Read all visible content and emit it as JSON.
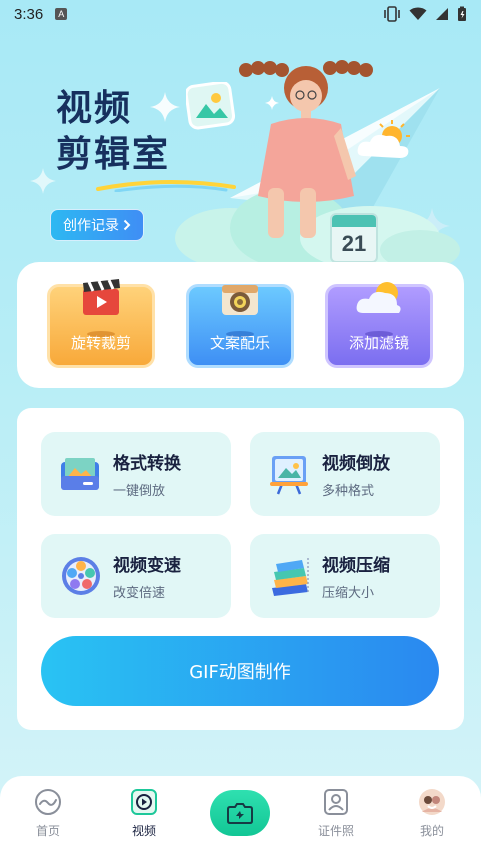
{
  "status": {
    "time": "3:36",
    "notification_letter": "A"
  },
  "hero": {
    "title_line1": "视频",
    "title_line2": "剪辑室",
    "record_button": "创作记录",
    "calendar_day": "21"
  },
  "tools": [
    {
      "label": "旋转裁剪",
      "icon": "clapperboard-icon",
      "color": "#f8a93a"
    },
    {
      "label": "文案配乐",
      "icon": "camera-icon",
      "color": "#3e8ff4"
    },
    {
      "label": "添加滤镜",
      "icon": "weather-cloud-sun-icon",
      "color": "#7b6ef0"
    }
  ],
  "features": [
    {
      "title": "格式转换",
      "subtitle": "一键倒放",
      "icon": "folder-image-icon"
    },
    {
      "title": "视频倒放",
      "subtitle": "多种格式",
      "icon": "presentation-screen-icon"
    },
    {
      "title": "视频变速",
      "subtitle": "改变倍速",
      "icon": "film-reel-icon"
    },
    {
      "title": "视频压缩",
      "subtitle": "压缩大小",
      "icon": "stacked-layers-icon"
    }
  ],
  "gif_button": "GIF动图制作",
  "nav": {
    "home": "首页",
    "video": "视频",
    "id_photo": "证件照",
    "me": "我的"
  },
  "colors": {
    "accent_blue": "#2a88f0",
    "accent_green": "#12c695",
    "title_navy": "#17305e"
  }
}
